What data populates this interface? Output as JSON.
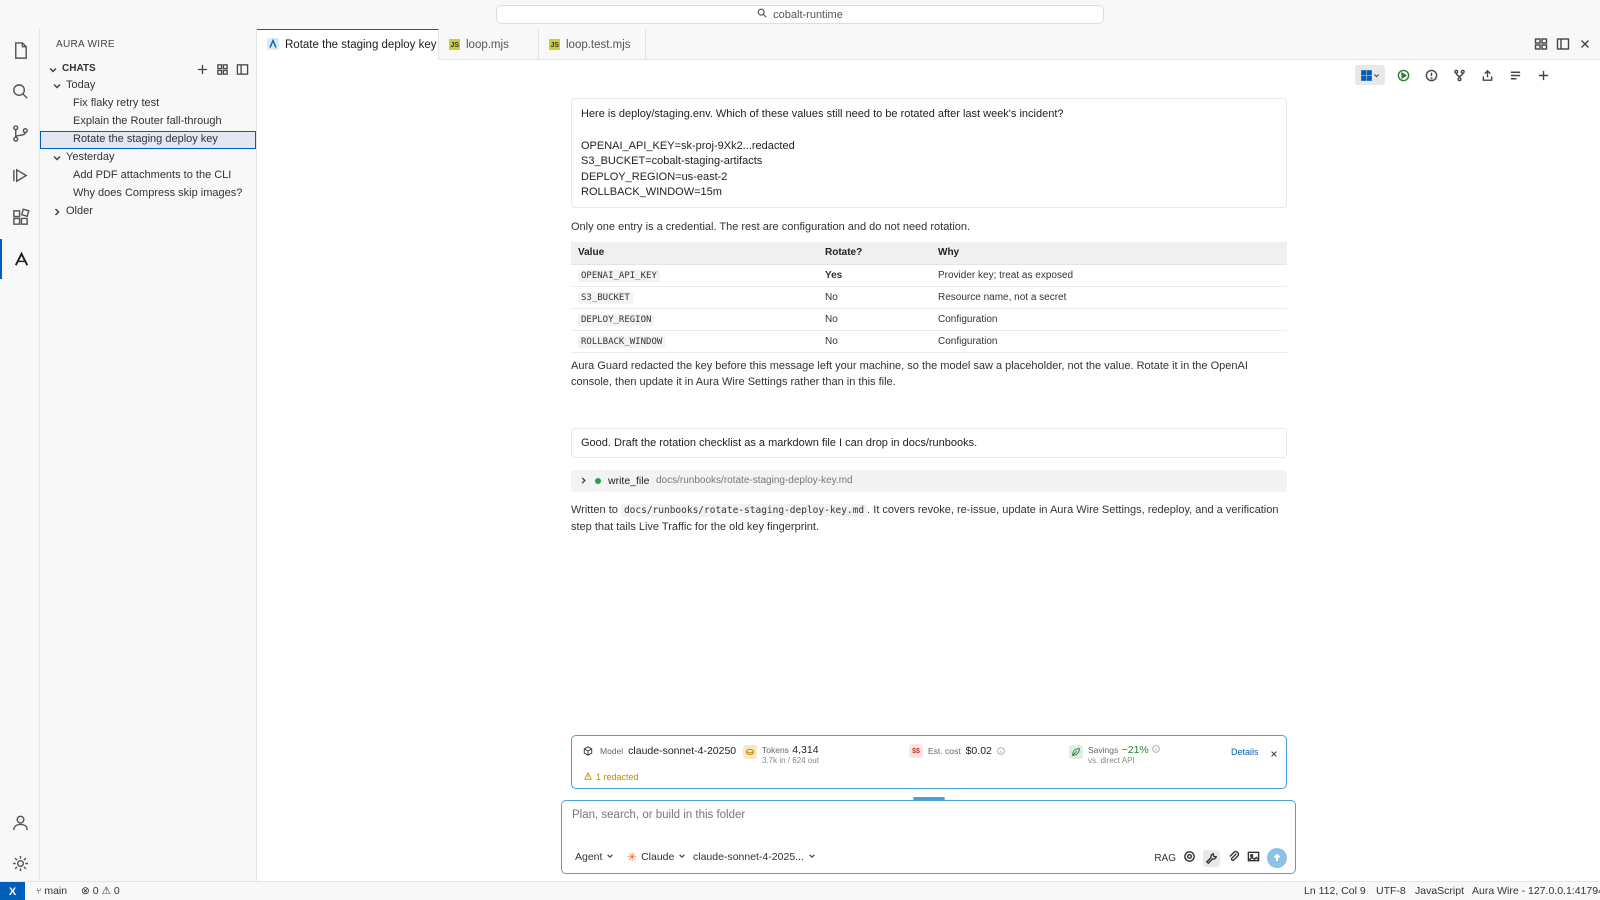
{
  "title_bar": {
    "search_text": "cobalt-runtime"
  },
  "sidebar": {
    "title": "AURA WIRE",
    "section": "CHATS",
    "groups": [
      {
        "label": "Today",
        "items": [
          "Fix flaky retry test",
          "Explain the Router fall-through",
          "Rotate the staging deploy key"
        ]
      },
      {
        "label": "Yesterday",
        "items": [
          "Add PDF attachments to the CLI",
          "Why does Compress skip images?"
        ]
      },
      {
        "label": "Older",
        "items": []
      }
    ],
    "selected_item": "Rotate the staging deploy key"
  },
  "tabs": [
    {
      "label": "Rotate the staging deploy key",
      "active": true
    },
    {
      "label": "loop.mjs",
      "active": false
    },
    {
      "label": "loop.test.mjs",
      "active": false
    }
  ],
  "chat": {
    "user_msg_1": {
      "intro": "Here is deploy/staging.env. Which of these values still need to be rotated after last week's incident?",
      "lines": [
        "OPENAI_API_KEY=sk-proj-9Xk2...redacted",
        "S3_BUCKET=cobalt-staging-artifacts",
        "DEPLOY_REGION=us-east-2",
        "ROLLBACK_WINDOW=15m"
      ]
    },
    "assistant_1_intro": "Only one entry is a credential. The rest are configuration and do not need rotation.",
    "table": {
      "headers": [
        "Value",
        "Rotate?",
        "Why"
      ],
      "rows": [
        [
          "OPENAI_API_KEY",
          "Yes",
          "Provider key; treat as exposed"
        ],
        [
          "S3_BUCKET",
          "No",
          "Resource name, not a secret"
        ],
        [
          "DEPLOY_REGION",
          "No",
          "Configuration"
        ],
        [
          "ROLLBACK_WINDOW",
          "No",
          "Configuration"
        ]
      ]
    },
    "assistant_1_outro": "Aura Guard redacted the key before this message left your machine, so the model saw a placeholder, not the value. Rotate it in the OpenAI console, then update it in Aura Wire Settings rather than in this file.",
    "user_msg_2": "Good. Draft the rotation checklist as a markdown file I can drop in docs/runbooks.",
    "tool_call": {
      "name": "write_file",
      "path": "docs/runbooks/rotate-staging-deploy-key.md"
    },
    "assistant_2": {
      "prefix": "Written to",
      "code": "docs/runbooks/rotate-staging-deploy-key.md",
      "suffix": ". It covers revoke, re-issue, update in Aura Wire Settings, redeploy, and a verification step that tails Live Traffic for the old key fingerprint."
    }
  },
  "usage": {
    "model_label": "Model",
    "model_value": "claude-sonnet-4-20250",
    "tokens_label": "Tokens",
    "tokens_value": "4,314",
    "tokens_sub": "3.7k in / 624 out",
    "cost_label": "Est. cost",
    "cost_value": "$0.02",
    "savings_label": "Savings",
    "savings_value": "−21%",
    "savings_sub": "vs. direct API",
    "details_label": "Details",
    "redacted": "1 redacted",
    "cost_icon_text": "$$"
  },
  "composer": {
    "placeholder": "Plan, search, or build in this folder",
    "mode": "Agent",
    "provider": "Claude",
    "model": "claude-sonnet-4-2025...",
    "rag_label": "RAG"
  },
  "status_bar": {
    "remote": "X",
    "branch": "main",
    "problems": "0",
    "warnings": "0",
    "position": "Ln 112, Col 9",
    "encoding": "UTF-8",
    "language": "JavaScript",
    "server": "Aura Wire - 127.0.0.1:41794"
  },
  "colors": {
    "accent": "#005fb8",
    "focus_border": "#4a9fd9",
    "savings_green": "#2e7d32",
    "warning": "#c08a00"
  }
}
